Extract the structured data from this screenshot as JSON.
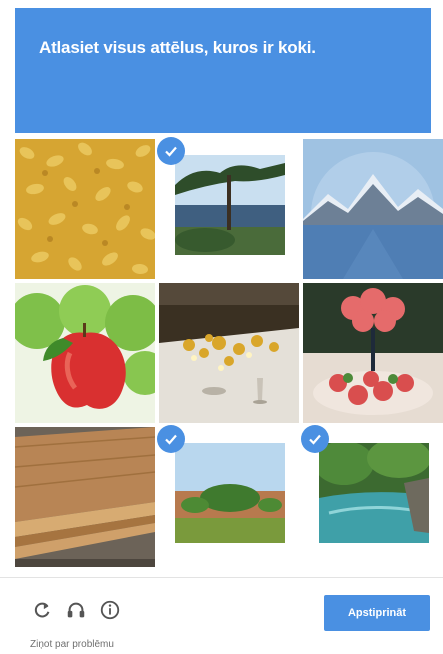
{
  "header": {
    "instruction_prefix": "Atlasiet visus attēlus, kuros ir ",
    "target_word": "koki",
    "instruction_suffix": "."
  },
  "tiles": [
    {
      "subject": "yellow leaves",
      "selected": false
    },
    {
      "subject": "tree by lake",
      "selected": true
    },
    {
      "subject": "mountains and lake",
      "selected": false
    },
    {
      "subject": "apples",
      "selected": false
    },
    {
      "subject": "table with candles",
      "selected": false
    },
    {
      "subject": "flower arrangement",
      "selected": false
    },
    {
      "subject": "wooden boards",
      "selected": false
    },
    {
      "subject": "bushes in field",
      "selected": true
    },
    {
      "subject": "river with trees",
      "selected": true
    }
  ],
  "footer": {
    "icons": [
      "reload-icon",
      "audio-icon",
      "info-icon"
    ],
    "verify_label": "Apstiprināt",
    "report_label": "Ziņot par problēmu"
  },
  "colors": {
    "accent": "#4a90e2"
  }
}
